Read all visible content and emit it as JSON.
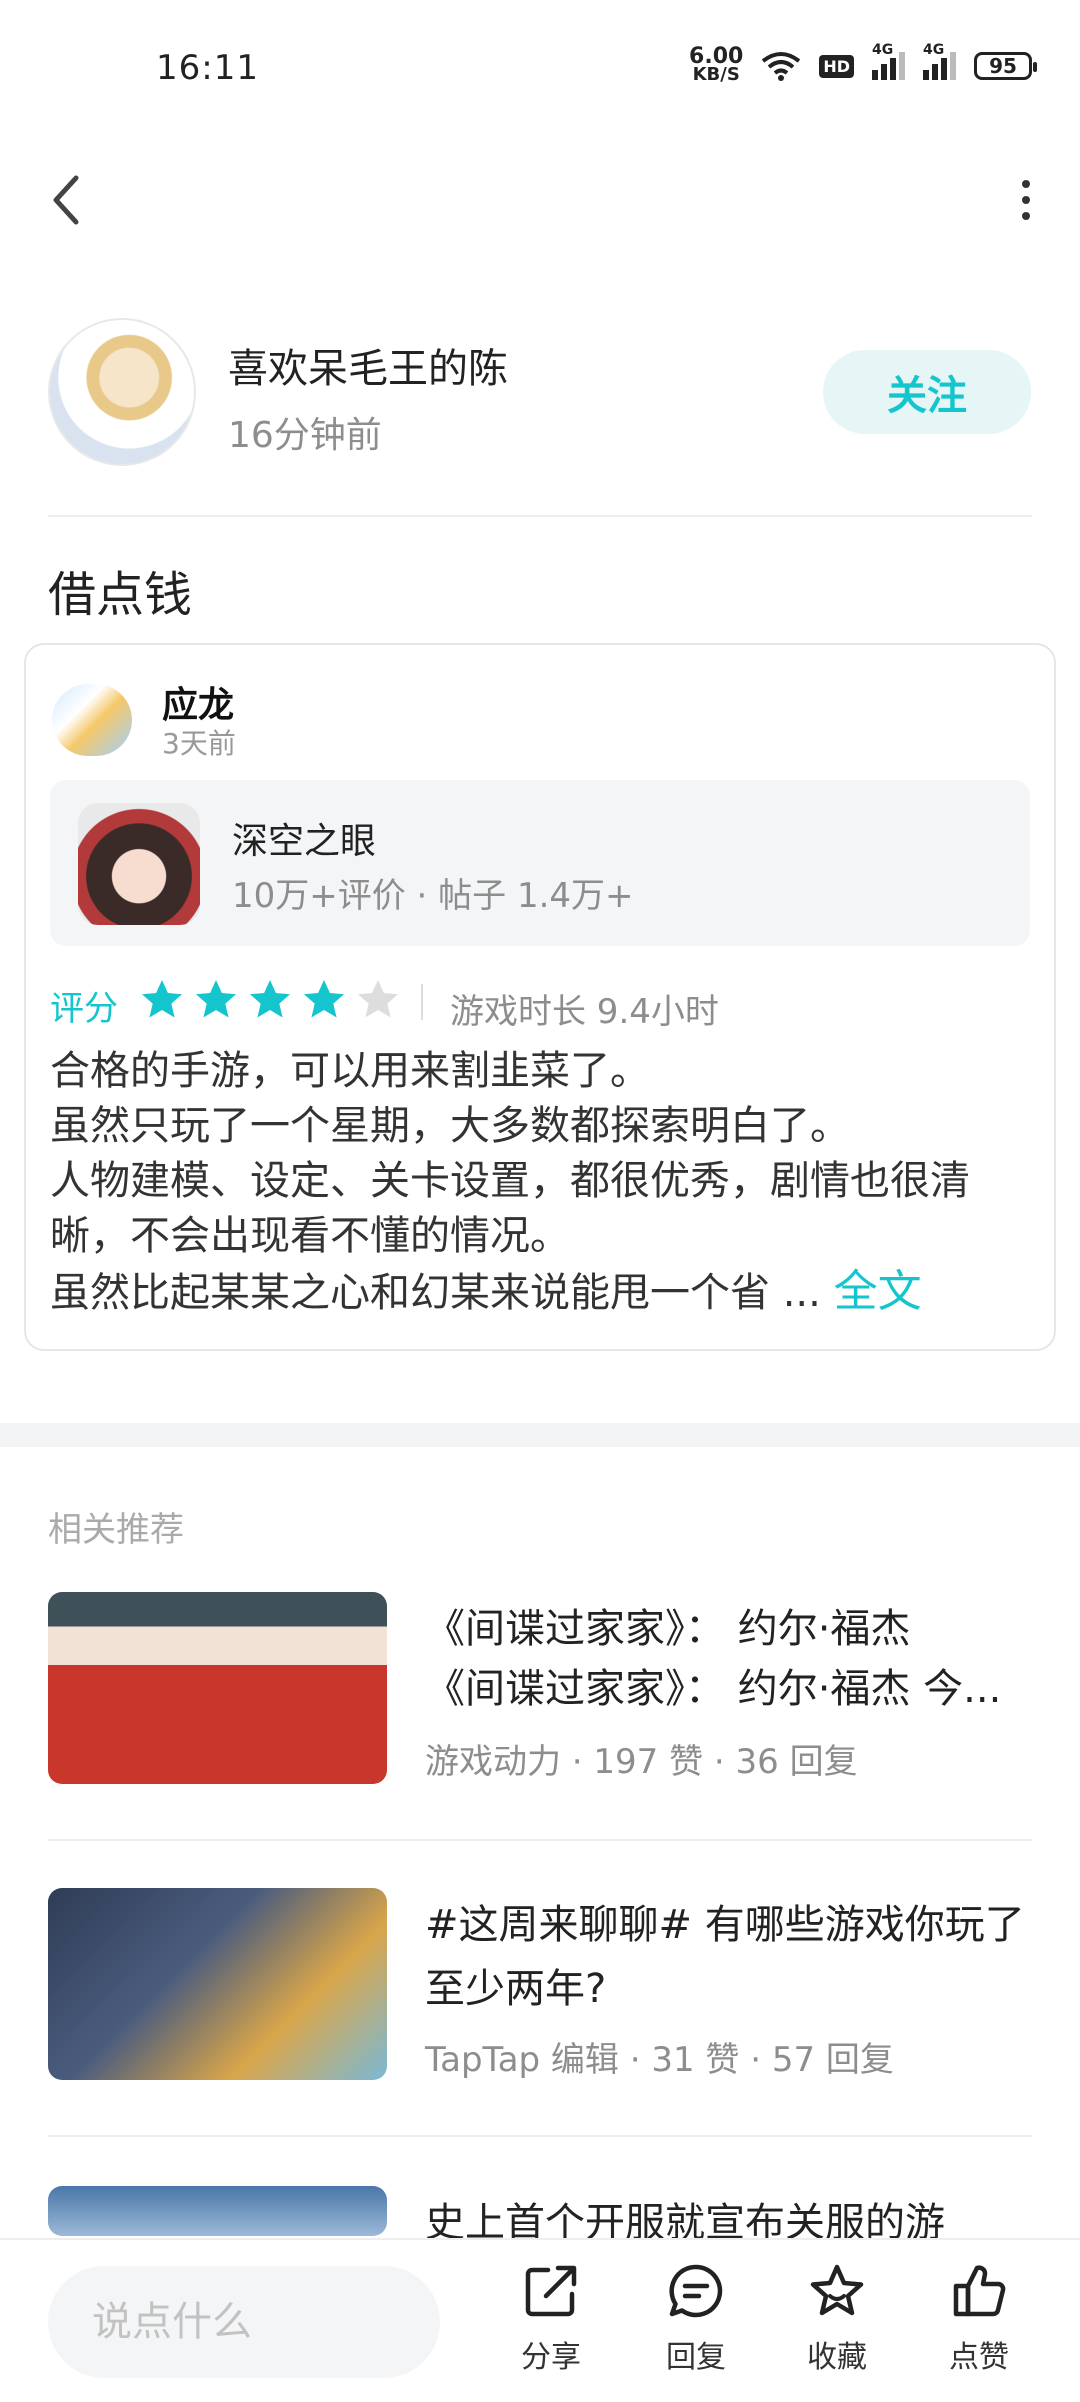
{
  "status_bar": {
    "time": "16:11",
    "net_speed_value": "6.00",
    "net_speed_unit": "KB/S",
    "hd_label": "HD",
    "signal1_label": "4G",
    "signal2_label": "4G",
    "battery": "95"
  },
  "author": {
    "name": "喜欢呆毛王的陈",
    "time": "16分钟前",
    "follow_label": "关注"
  },
  "post": {
    "title": "借点钱"
  },
  "review": {
    "reviewer_name": "应龙",
    "reviewer_time": "3天前",
    "game_name": "深空之眼",
    "game_meta": "10万+评价 · 帖子 1.4万+",
    "score_label": "评分",
    "rating": 4,
    "rating_max": 5,
    "playtime": "游戏时长 9.4小时",
    "lines": [
      "合格的手游，可以用来割韭菜了。",
      "虽然只玩了一个星期，大多数都探索明白了。",
      "人物建模、设定、关卡设置，都很优秀，剧情也很清",
      "晰，不会出现看不懂的情况。",
      "虽然比起某某之心和幻某来说能甩一个省 ..."
    ],
    "full_text_label": "全文"
  },
  "related": {
    "title": "相关推荐",
    "items": [
      {
        "line1": "《间谍过家家》： 约尔·福杰",
        "line2": "《间谍过家家》： 约尔·福杰 今...",
        "meta": "游戏动力 · 197 赞 · 36 回复"
      },
      {
        "line1": "#这周来聊聊# 有哪些游戏你玩了",
        "line2": "至少两年?",
        "meta": "TapTap 编辑 · 31 赞 · 57 回复"
      },
      {
        "line1": "史上首个开服就宣布关服的游"
      }
    ]
  },
  "bottom_bar": {
    "comment_placeholder": "说点什么",
    "share_label": "分享",
    "reply_label": "回复",
    "favorite_label": "收藏",
    "like_label": "点赞"
  },
  "colors": {
    "accent": "#15c5ce",
    "follow_bg": "#e6f6f7",
    "star_empty": "#dddddd"
  }
}
